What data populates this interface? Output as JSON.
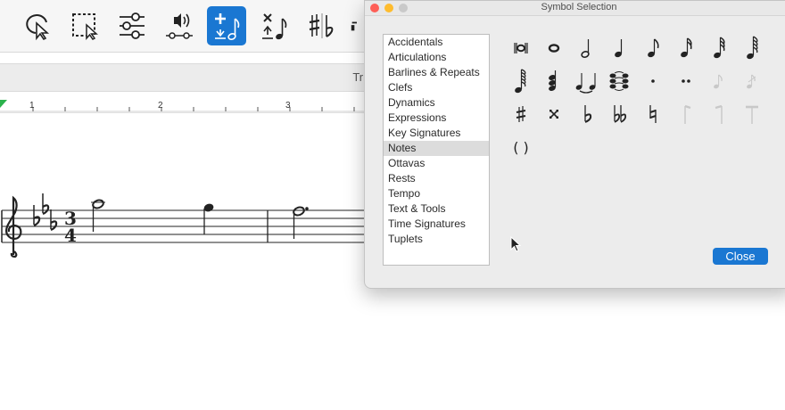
{
  "toolbar": {
    "tools": [
      {
        "name": "select-tool",
        "icon": "pointer-lasso-icon"
      },
      {
        "name": "marquee-tool",
        "icon": "marquee-select-icon"
      },
      {
        "name": "mixer-tool",
        "icon": "sliders-icon"
      },
      {
        "name": "playback-tool",
        "icon": "playback-speaker-icon"
      },
      {
        "name": "add-note-tool",
        "icon": "add-note-icon",
        "active": true
      },
      {
        "name": "delete-note-tool",
        "icon": "delete-note-icon"
      },
      {
        "name": "accidentals-tool",
        "icon": "sharp-flat-icon"
      },
      {
        "name": "notes-tool-partial",
        "icon": "note-icon"
      }
    ],
    "accent_color": "#1a77d2"
  },
  "secondary_band": {
    "partial_label": "Tri"
  },
  "ruler": {
    "marks": [
      "1",
      "2",
      "3"
    ]
  },
  "score": {
    "key_signature": "three-flats",
    "time_signature": {
      "top": "3",
      "bottom": "4"
    }
  },
  "dialog": {
    "title": "Symbol Selection",
    "categories": [
      "Accidentals",
      "Articulations",
      "Barlines & Repeats",
      "Clefs",
      "Dynamics",
      "Expressions",
      "Key Signatures",
      "Notes",
      "Ottavas",
      "Rests",
      "Tempo",
      "Text & Tools",
      "Time Signatures",
      "Tuplets"
    ],
    "selected_category": "Notes",
    "symbols": [
      "breve-icon",
      "whole-note-icon",
      "half-note-icon",
      "quarter-note-icon",
      "eighth-note-icon",
      "sixteenth-note-icon",
      "thirty-second-note-icon",
      "sixty-fourth-note-icon",
      "one-twenty-eighth-note-icon",
      "chord-cluster-icon",
      "tied-notes-icon",
      "tied-chord-icon",
      "dot-icon",
      "double-dot-icon",
      "grace-note-icon",
      "grace-note-slash-icon",
      "sharp-icon",
      "double-sharp-icon",
      "flat-icon",
      "double-flat-icon",
      "natural-icon",
      "flag-up-icon",
      "flag-down-icon",
      "beam-stub-icon",
      "parentheses-icon"
    ],
    "parentheses_text": "( )",
    "close_label": "Close",
    "colors": {
      "red": "#fe5f57",
      "yellow": "#febc2e",
      "green": "#c9c9c9"
    }
  }
}
